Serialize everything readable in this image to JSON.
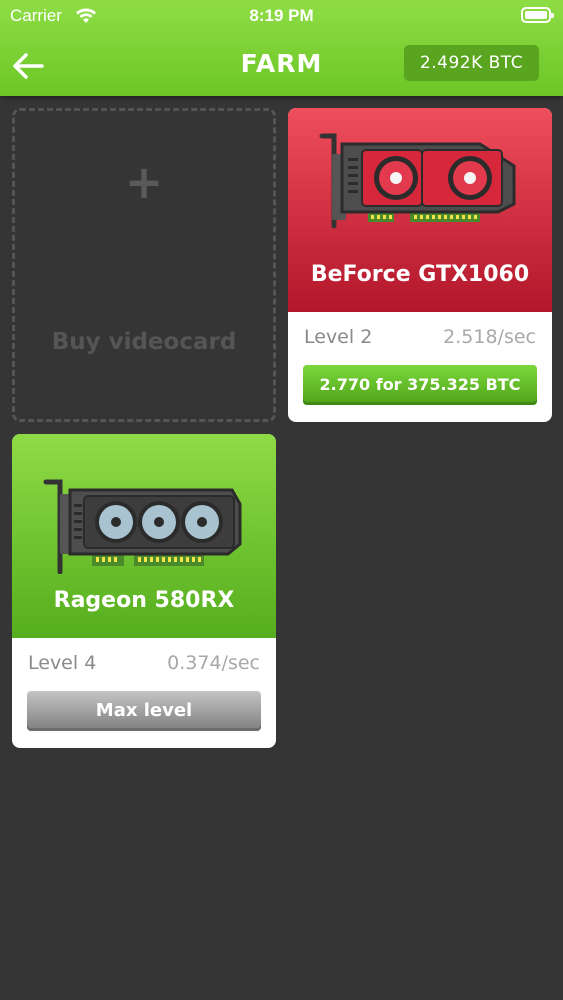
{
  "status_bar": {
    "carrier": "Carrier",
    "time": "8:19 PM"
  },
  "header": {
    "title": "FARM",
    "balance": "2.492K BTC"
  },
  "buy_slot": {
    "plus": "+",
    "label": "Buy videocard"
  },
  "cards": [
    {
      "name": "BeForce GTX1060",
      "level": "Level 2",
      "rate": "2.518/sec",
      "button": "2.770 for 375.325 BTC",
      "theme": "red",
      "accent": "#e23a4c"
    },
    {
      "name": "Rageon 580RX",
      "level": "Level 4",
      "rate": "0.374/sec",
      "button": "Max level",
      "theme": "green",
      "accent": "#6cc626"
    }
  ],
  "icons": {
    "back": "back-arrow-icon",
    "wifi": "wifi-icon",
    "battery": "battery-icon",
    "plus": "plus-icon",
    "gpu": "videocard-icon"
  }
}
